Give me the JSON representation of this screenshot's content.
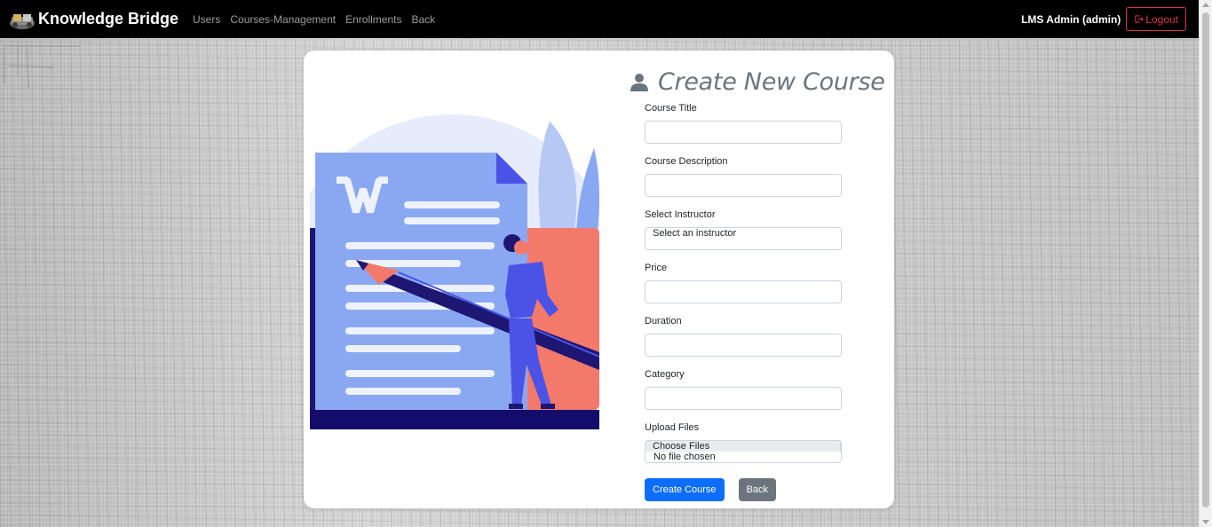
{
  "navbar": {
    "brand": "Knowledge Bridge",
    "links": [
      "Users",
      "Courses-Management",
      "Enrollments",
      "Back"
    ],
    "user": "LMS Admin (admin)",
    "logout": "Logout"
  },
  "form": {
    "title": "Create New Course",
    "fields": {
      "title": {
        "label": "Course Title",
        "value": ""
      },
      "description": {
        "label": "Course Description",
        "value": ""
      },
      "instructor": {
        "label": "Select Instructor",
        "value": "Select an instructor"
      },
      "price": {
        "label": "Price",
        "value": ""
      },
      "duration": {
        "label": "Duration",
        "value": ""
      },
      "category": {
        "label": "Category",
        "value": ""
      },
      "files": {
        "label": "Upload Files",
        "button": "Choose Files",
        "status": "No file chosen"
      }
    },
    "submit": "Create Course",
    "back": "Back"
  },
  "colors": {
    "primary": "#0d6efd",
    "secondary": "#6c757d",
    "danger": "#dc3545",
    "illustration_blue": "#8aa8f2",
    "illustration_coral": "#f37a6b",
    "illustration_navy": "#1e1673"
  },
  "icons": [
    "brand-logo-icon",
    "logout-icon",
    "user-icon",
    "document-illustration"
  ]
}
